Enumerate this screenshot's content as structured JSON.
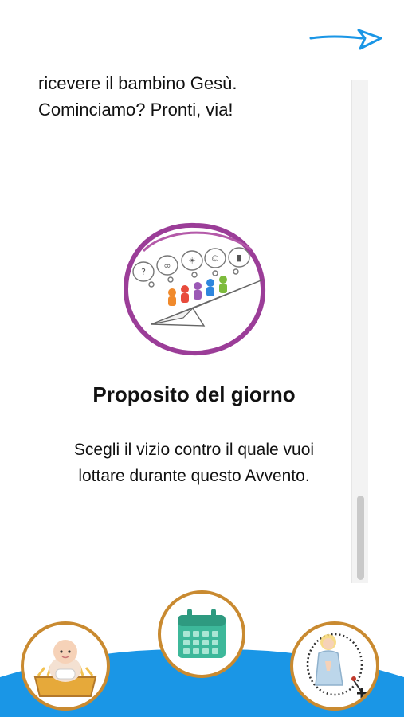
{
  "intro": {
    "line1": "ricevere il bambino Gesù.",
    "line2": "Cominciamo? Pronti, via!"
  },
  "section": {
    "title": "Proposito del giorno",
    "description": "Scegli il vizio contro il quale vuoi lottare durante questo Avvento."
  },
  "colors": {
    "accent": "#1a96e6",
    "ring_purple": "#9b3d98",
    "nav_border": "#c98a30",
    "calendar": "#3db89a",
    "wave": "#1a96e6"
  },
  "icons": {
    "send": "paper-plane-arrow-icon",
    "logo": "paper-plane-people-logo",
    "nav_left": "baby-jesus-manger-icon",
    "nav_center": "calendar-icon",
    "nav_right": "rosary-praying-figure-icon"
  }
}
